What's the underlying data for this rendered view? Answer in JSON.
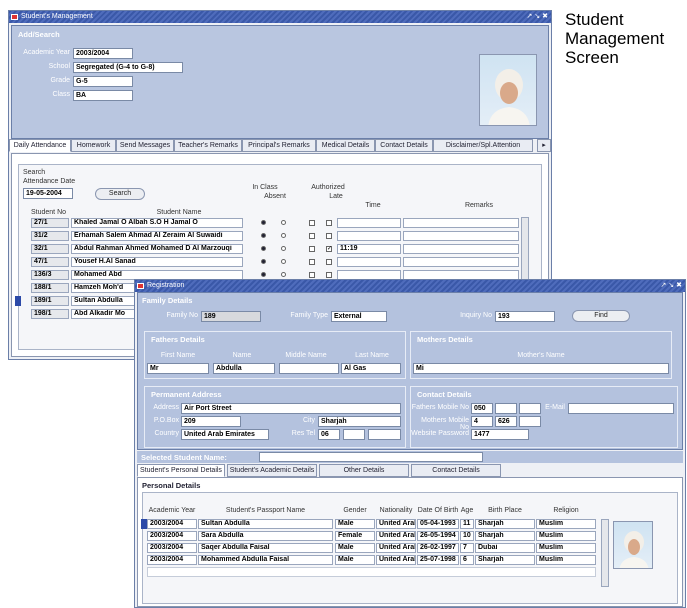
{
  "caption": [
    "Student",
    "Management",
    "Screen"
  ],
  "main_window": {
    "title": "Student's Management",
    "controls": "↗ ↘ ✖",
    "section": "Add/Search",
    "academic_year": {
      "label": "Academic Year",
      "value": "2003/2004"
    },
    "school": {
      "label": "School",
      "value": "Segregated (G-4 to G-8)"
    },
    "grade": {
      "label": "Grade",
      "value": "G-5"
    },
    "class": {
      "label": "Class",
      "value": "BA"
    },
    "tabs": [
      "Daily Attendance",
      "Homework",
      "Send Messages",
      "Teacher's Remarks",
      "Principal's Remarks",
      "Medical Details",
      "Contact Details",
      "Disclaimer/Spl.Attention"
    ],
    "search": {
      "title": "Search",
      "date_label": "Attendance Date",
      "date_value": "19-05-2004",
      "button": "Search"
    },
    "columns": {
      "student_no": "Student No",
      "student_name": "Student Name",
      "in_class": "In Class",
      "absent": "Absent",
      "authorized": "Authorized",
      "late": "Late",
      "time": "Time",
      "remarks": "Remarks"
    },
    "rows": [
      {
        "no": "27/1",
        "name": "Khaled Jamal O Albah S.O H Jamal O",
        "time": ""
      },
      {
        "no": "31/2",
        "name": "Erhamah Salem Ahmad Al Zeraim Al Suwaidi",
        "time": ""
      },
      {
        "no": "32/1",
        "name": "Abdul Rahman Ahmed Mohamed D Al Marzouqi",
        "time": "11:19"
      },
      {
        "no": "47/1",
        "name": "Yousef H.Al Sanad",
        "time": ""
      },
      {
        "no": "136/3",
        "name": "Mohamed Abd",
        "time": ""
      },
      {
        "no": "188/1",
        "name": "Hamzeh Moh'd",
        "time": ""
      },
      {
        "no": "189/1",
        "name": "Sultan Abdulla",
        "time": ""
      },
      {
        "no": "198/1",
        "name": "Abd Alkadir Mo",
        "time": ""
      }
    ]
  },
  "reg_window": {
    "title": "Registration",
    "controls": "↗ ↘ ✖",
    "family_details": "Family Details",
    "family_no": {
      "label": "Family No",
      "value": "189"
    },
    "family_type": {
      "label": "Family Type",
      "value": "External"
    },
    "inquiry_no": {
      "label": "Inquiry No",
      "value": "193"
    },
    "find_button": "Find",
    "fathers_details": "Fathers Details",
    "mothers_details": "Mothers Details",
    "father_cols": [
      "First Name",
      "Name",
      "Middle Name",
      "Last Name"
    ],
    "father_vals": [
      "Mr",
      "Abdulla",
      "",
      "Al Gas"
    ],
    "mother_col": "Mother's Name",
    "mother_val": "Mi",
    "permanent_address": "Permanent Address",
    "address": {
      "label": "Address",
      "value": "Air Port Street"
    },
    "po_box": {
      "label": "P.O.Box",
      "value": "209"
    },
    "city": {
      "label": "City",
      "value": "Sharjah"
    },
    "country": {
      "label": "Country",
      "value": "United Arab Emirates"
    },
    "res_tel": {
      "label": "Res Tel",
      "value": "06"
    },
    "contact_details": "Contact Details",
    "fathers_mobile": {
      "label": "Fathers Mobile No",
      "value": "050"
    },
    "email": {
      "label": "E-Mail",
      "value": ""
    },
    "mothers_mobile": {
      "label": "Mothers Mobile No",
      "value": "4",
      "value2": "626"
    },
    "website_password": {
      "label": "Website Password",
      "value": "1477"
    },
    "selected_student": "Selected Student Name:",
    "tabs": [
      "Student's Personal Details",
      "Student's Academic Details",
      "Other Details",
      "Contact Details"
    ],
    "personal_details": "Personal Details",
    "columns": [
      "Academic Year",
      "Student's Passport Name",
      "Gender",
      "Nationality",
      "Date Of Birth",
      "Age",
      "Birth Place",
      "Religion"
    ],
    "rows": [
      [
        "2003/2004",
        "Sultan Abdulla",
        "Male",
        "United Arab Er",
        "05-04-1993",
        "11",
        "Sharjah",
        "Muslim"
      ],
      [
        "2003/2004",
        "Sara Abdulla",
        "Female",
        "United Arab Er",
        "26-05-1994",
        "10",
        "Sharjah",
        "Muslim"
      ],
      [
        "2003/2004",
        "Saqer Abdulla Faisal",
        "Male",
        "United Arab Er",
        "26-02-1997",
        "7",
        "Dubai",
        "Muslim"
      ],
      [
        "2003/2004",
        "Mohammed Abdulla Faisal",
        "Male",
        "United Arab Er",
        "25-07-1998",
        "6",
        "Sharjah",
        "Muslim"
      ]
    ]
  },
  "colors": {
    "title_bar": "#3a58a8",
    "panel": "#cdd6e8",
    "selection": "#2c4aa8"
  }
}
